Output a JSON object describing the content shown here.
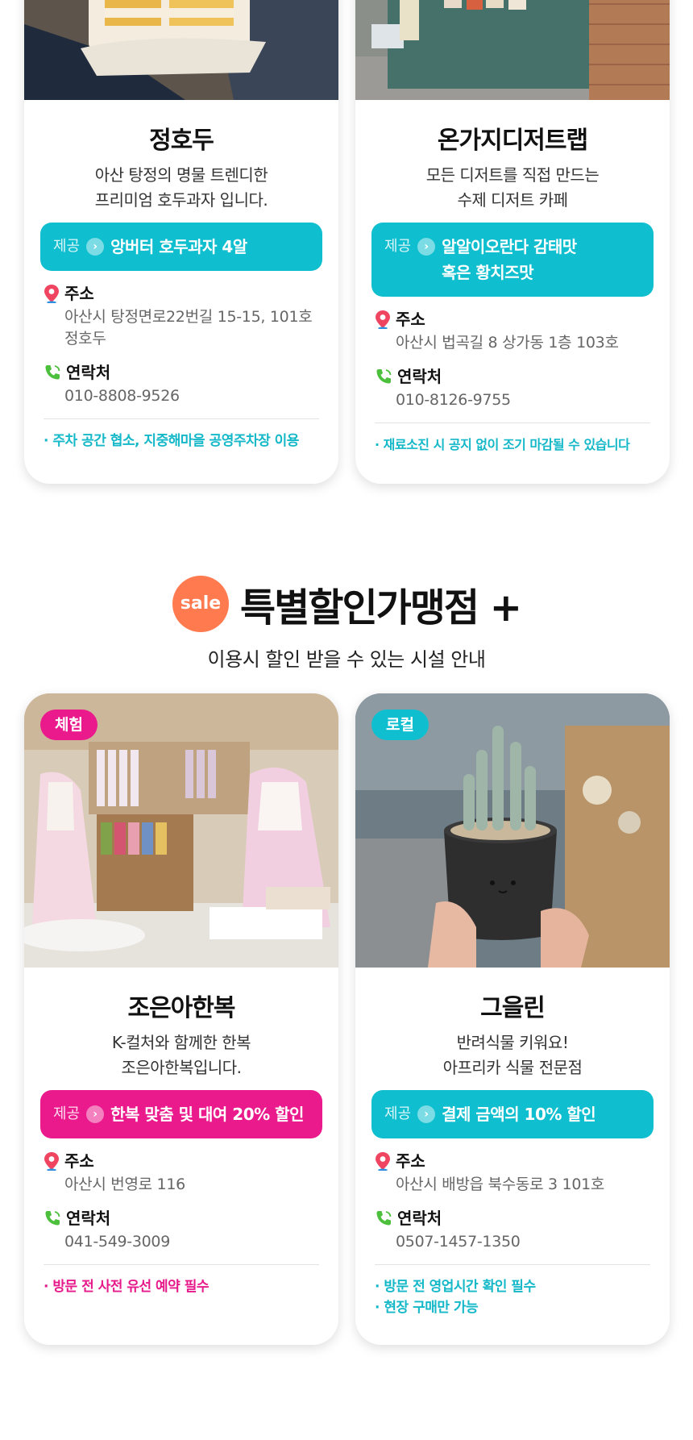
{
  "labels": {
    "offer_label": "제공",
    "address_label": "주소",
    "contact_label": "연락처"
  },
  "section": {
    "sale_badge": "sale",
    "title": "특별할인가맹점 +",
    "subtitle": "이용시 할인 받을 수 있는 시설 안내"
  },
  "cards": [
    {
      "name": "정호두",
      "desc": [
        "아산 탕정의 명물 트렌디한",
        "프리미엄 호두과자 입니다."
      ],
      "offer": [
        "앙버터 호두과자 4알"
      ],
      "address": [
        "아산시 탕정면로22번길 15-15, 101호",
        "정호두"
      ],
      "phone": "010-8808-9526",
      "notes": [
        "· 주차 공간 협소, 지중해마을 공영주차장 이용"
      ],
      "accent": "#10bfcf"
    },
    {
      "name": "온가지디저트랩",
      "desc": [
        "모든 디저트를 직접 만드는",
        "수제 디저트 카페"
      ],
      "offer": [
        "알알이오란다 감태맛",
        "혹은 황치즈맛"
      ],
      "address": [
        "아산시 법곡길 8 상가동 1층 103호"
      ],
      "phone": "010-8126-9755",
      "notes": [
        "· 재료소진 시 공지 없이 조기 마감될 수 있습니다"
      ],
      "accent": "#10bfcf"
    },
    {
      "badge": "체험",
      "name": "조은아한복",
      "desc": [
        "K-컬처와 함께한 한복",
        "조은아한복입니다."
      ],
      "offer": [
        "한복 맞춤 및 대여 20% 할인"
      ],
      "address": [
        "아산시 번영로 116"
      ],
      "phone": "041-549-3009",
      "notes": [
        "· 방문 전 사전 유선 예약 필수"
      ],
      "accent": "#ea1a8c"
    },
    {
      "badge": "로컬",
      "name": "그을린",
      "desc": [
        "반려식물 키워요!",
        "아프리카 식물 전문점"
      ],
      "offer": [
        "결제 금액의 10% 할인"
      ],
      "address": [
        "아산시 배방읍 북수동로 3 101호"
      ],
      "phone": "0507-1457-1350",
      "notes": [
        "· 방문 전 영업시간 확인 필수",
        "· 현장 구매만 가능"
      ],
      "accent": "#10bfcf"
    }
  ],
  "icons": {
    "pin": "location-pin-icon",
    "phone": "phone-icon",
    "arrow": "arrow-right-circle-icon"
  }
}
